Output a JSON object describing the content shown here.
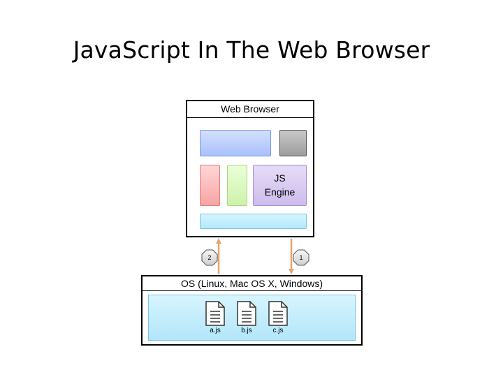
{
  "slide": {
    "title": "JavaScript In The Web Browser"
  },
  "browser": {
    "title": "Web Browser",
    "js_engine_line1": "JS",
    "js_engine_line2": "Engine"
  },
  "os": {
    "title": "OS (Linux, Mac OS X, Windows)",
    "files": [
      {
        "name": "a.js",
        "icon": "document-icon"
      },
      {
        "name": "b.js",
        "icon": "document-icon"
      },
      {
        "name": "c.js",
        "icon": "document-icon"
      }
    ]
  },
  "steps": {
    "step1": "1",
    "step2": "2"
  },
  "colors": {
    "arrow": "#e8a46a",
    "component_blue": "#a9c0fb",
    "component_gray": "#9c9c9c",
    "component_red": "#f7a4a4",
    "component_green": "#cdf2ac",
    "component_purple": "#cdbcec",
    "component_cyan": "#b4e8fb"
  }
}
